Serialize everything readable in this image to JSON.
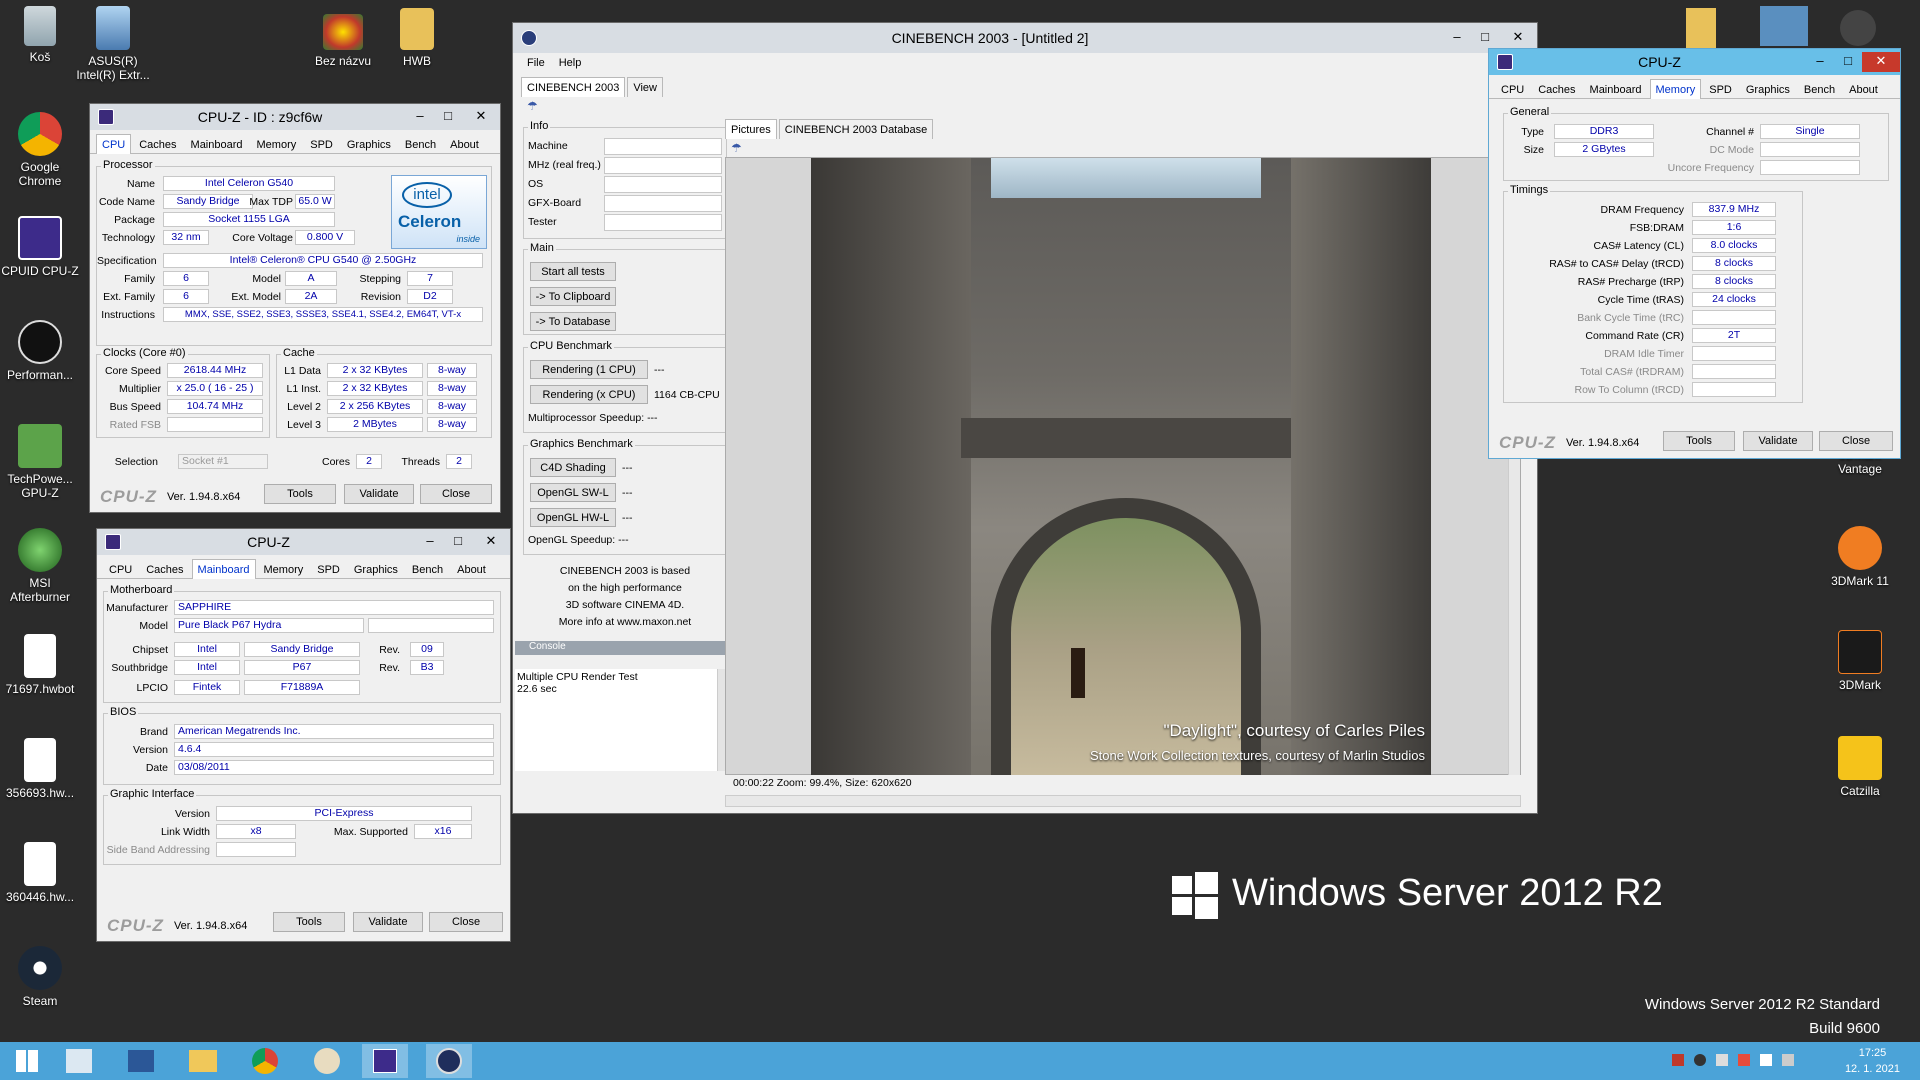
{
  "desktop": {
    "left_icons": [
      "Koš",
      "ASUS(R) Intel(R) Extr...",
      "Bez názvu",
      "HWB",
      "Google Chrome",
      "CPUID CPU-Z",
      "Performan...",
      "TechPowe... GPU-Z",
      "MSI Afterburner",
      "71697.hwbot",
      "356693.hw...",
      "360446.hw...",
      "Steam"
    ],
    "right_icons": [
      "3DMark Vantage",
      "3DMark 11",
      "3DMark",
      "Catzilla"
    ],
    "os_logo": "Windows Server 2012 R2",
    "os_edition": "Windows Server 2012 R2 Standard",
    "build": "Build 9600"
  },
  "taskbar": {
    "time": "17:25",
    "date": "12. 1. 2021"
  },
  "cpuz_cpu": {
    "title": "CPU-Z - ID : z9cf6w",
    "tabs": [
      "CPU",
      "Caches",
      "Mainboard",
      "Memory",
      "SPD",
      "Graphics",
      "Bench",
      "About"
    ],
    "processor_label": "Processor",
    "name_lbl": "Name",
    "name": "Intel Celeron G540",
    "codename_lbl": "Code Name",
    "codename": "Sandy Bridge",
    "maxtdp_lbl": "Max TDP",
    "maxtdp": "65.0 W",
    "package_lbl": "Package",
    "package": "Socket 1155 LGA",
    "tech_lbl": "Technology",
    "tech": "32 nm",
    "cv_lbl": "Core Voltage",
    "cv": "0.800 V",
    "spec_lbl": "Specification",
    "spec": "Intel® Celeron® CPU G540 @ 2.50GHz",
    "family_lbl": "Family",
    "family": "6",
    "model_lbl": "Model",
    "model": "A",
    "stepping_lbl": "Stepping",
    "stepping": "7",
    "extfam_lbl": "Ext. Family",
    "extfam": "6",
    "extmodel_lbl": "Ext. Model",
    "extmodel": "2A",
    "revision_lbl": "Revision",
    "revision": "D2",
    "instr_lbl": "Instructions",
    "instr": "MMX, SSE, SSE2, SSE3, SSSE3, SSE4.1, SSE4.2, EM64T, VT-x",
    "clocks_label": "Clocks (Core #0)",
    "corespeed_lbl": "Core Speed",
    "corespeed": "2618.44 MHz",
    "mult_lbl": "Multiplier",
    "mult": "x 25.0 ( 16 - 25 )",
    "bus_lbl": "Bus Speed",
    "bus": "104.74 MHz",
    "fsb_lbl": "Rated FSB",
    "cache_label": "Cache",
    "l1d_lbl": "L1 Data",
    "l1d": "2 x 32 KBytes",
    "l1d_w": "8-way",
    "l1i_lbl": "L1 Inst.",
    "l1i": "2 x 32 KBytes",
    "l1i_w": "8-way",
    "l2_lbl": "Level 2",
    "l2": "2 x 256 KBytes",
    "l2_w": "8-way",
    "l3_lbl": "Level 3",
    "l3": "2 MBytes",
    "l3_w": "8-way",
    "sel_lbl": "Selection",
    "sel": "Socket #1",
    "cores_lbl": "Cores",
    "cores": "2",
    "threads_lbl": "Threads",
    "threads": "2",
    "badge_brand": "intel",
    "badge_name": "Celeron",
    "badge_inside": "inside",
    "logo": "CPU-Z",
    "ver": "Ver. 1.94.8.x64",
    "tools": "Tools",
    "validate": "Validate",
    "close": "Close"
  },
  "cpuz_mb": {
    "title": "CPU-Z",
    "mb_label": "Motherboard",
    "manuf_lbl": "Manufacturer",
    "manuf": "SAPPHIRE",
    "model_lbl": "Model",
    "model": "Pure Black P67 Hydra",
    "chipset_lbl": "Chipset",
    "chipset_v": "Intel",
    "chipset_n": "Sandy Bridge",
    "rev_lbl": "Rev.",
    "chipset_rev": "09",
    "sb_lbl": "Southbridge",
    "sb_v": "Intel",
    "sb_n": "P67",
    "sb_rev": "B3",
    "lpcio_lbl": "LPCIO",
    "lpcio_v": "Fintek",
    "lpcio_n": "F71889A",
    "bios_label": "BIOS",
    "brand_lbl": "Brand",
    "brand": "American Megatrends Inc.",
    "version_lbl": "Version",
    "version": "4.6.4",
    "date_lbl": "Date",
    "date": "03/08/2011",
    "gi_label": "Graphic Interface",
    "giver_lbl": "Version",
    "giver": "PCI-Express",
    "lw_lbl": "Link Width",
    "lw": "x8",
    "maxs_lbl": "Max. Supported",
    "maxs": "x16",
    "sba_lbl": "Side Band Addressing"
  },
  "cpuz_mem": {
    "title": "CPU-Z",
    "general_label": "General",
    "type_lbl": "Type",
    "type": "DDR3",
    "channel_lbl": "Channel #",
    "channel": "Single",
    "size_lbl": "Size",
    "size": "2 GBytes",
    "dcmode_lbl": "DC Mode",
    "uncore_lbl": "Uncore Frequency",
    "timings_label": "Timings",
    "dram_lbl": "DRAM Frequency",
    "dram": "837.9 MHz",
    "fsbdram_lbl": "FSB:DRAM",
    "fsbdram": "1:6",
    "cl_lbl": "CAS# Latency (CL)",
    "cl": "8.0 clocks",
    "trcd_lbl": "RAS# to CAS# Delay (tRCD)",
    "trcd": "8 clocks",
    "trp_lbl": "RAS# Precharge (tRP)",
    "trp": "8 clocks",
    "tras_lbl": "Cycle Time (tRAS)",
    "tras": "24 clocks",
    "trc_lbl": "Bank Cycle Time (tRC)",
    "cr_lbl": "Command Rate (CR)",
    "cr": "2T",
    "idle_lbl": "DRAM Idle Timer",
    "trdram_lbl": "Total CAS# (tRDRAM)",
    "rtc_lbl": "Row To Column (tRCD)"
  },
  "cinebench": {
    "title": "CINEBENCH 2003 - [Untitled 2]",
    "menu_file": "File",
    "menu_help": "Help",
    "tab1": "CINEBENCH 2003",
    "tab2": "View",
    "info_label": "Info",
    "machine": "Machine",
    "mhz": "MHz (real freq.)",
    "os": "OS",
    "gfx": "GFX-Board",
    "tester": "Tester",
    "main_label": "Main",
    "start": "Start all tests",
    "clip": "-> To Clipboard",
    "db": "-> To Database",
    "cpub_label": "CPU Benchmark",
    "r1": "Rendering (1 CPU)",
    "r1_val": "---",
    "rx": "Rendering (x CPU)",
    "rx_val": "1164 CB-CPU",
    "mps": "Multiprocessor Speedup: ---",
    "gb_label": "Graphics Benchmark",
    "c4d": "C4D Shading",
    "c4d_val": "---",
    "swl": "OpenGL SW-L",
    "swl_val": "---",
    "hwl": "OpenGL HW-L",
    "hwl_val": "---",
    "ogs": "OpenGL Speedup: ---",
    "about1": "CINEBENCH 2003 is based",
    "about2": "on the high performance",
    "about3": "3D software CINEMA 4D.",
    "about4": "More info at www.maxon.net",
    "console_label": "Console",
    "console1": "Multiple CPU Render Test",
    "console2": "22.6 sec",
    "ptab1": "Pictures",
    "ptab2": "CINEBENCH 2003 Database",
    "caption1": "\"Daylight\", courtesy of Carles Piles",
    "caption2": "Stone Work Collection textures, courtesy of Marlin Studios",
    "status": "00:00:22  Zoom: 99.4%, Size: 620x620"
  }
}
